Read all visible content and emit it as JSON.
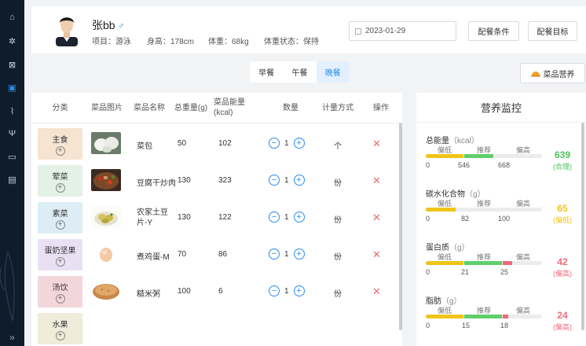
{
  "user": {
    "name": "张bb",
    "gender_symbol": "♂",
    "project": "项目：游泳",
    "height": "身高：178cm",
    "weight": "体重：68kg",
    "body_status": "体重状态：保持"
  },
  "header": {
    "date": "2023-01-29",
    "btn_conditions": "配餐条件",
    "btn_goals": "配餐目标"
  },
  "meals": [
    "早餐",
    "午餐",
    "晚餐"
  ],
  "active_meal": "晚餐",
  "nutrition_button": "菜品营养",
  "table": {
    "columns": [
      "分类",
      "菜品图片",
      "菜品名称",
      "总重量(g)",
      "菜品能量\n(kcal)",
      "数量",
      "计量方式",
      "操作"
    ],
    "categories": [
      {
        "label": "主食",
        "color": "#f6e3d0"
      },
      {
        "label": "荤菜",
        "color": "#e3f1e6"
      },
      {
        "label": "素菜",
        "color": "#dcedf5"
      },
      {
        "label": "蛋奶坚果",
        "color": "#e9e1f3"
      },
      {
        "label": "汤饮",
        "color": "#f3d6dc"
      },
      {
        "label": "水果",
        "color": "#efedd9"
      }
    ],
    "rows": [
      {
        "name": "菜包",
        "weight": "50",
        "energy": "102",
        "qty": "1",
        "unit": "个",
        "img": "bun"
      },
      {
        "name": "豆腐干炒肉",
        "weight": "130",
        "energy": "323",
        "qty": "1",
        "unit": "份",
        "img": "stirfry"
      },
      {
        "name": "农家土豆\n片-Y",
        "weight": "130",
        "energy": "122",
        "qty": "1",
        "unit": "份",
        "img": "potato"
      },
      {
        "name": "煮鸡蛋-M",
        "weight": "70",
        "energy": "86",
        "qty": "1",
        "unit": "份",
        "img": "egg"
      },
      {
        "name": "糙米粥",
        "weight": "100",
        "energy": "6",
        "qty": "1",
        "unit": "份",
        "img": "porridge"
      }
    ]
  },
  "monitor": {
    "title": "营养监控",
    "labels": {
      "low": "偏低",
      "rec": "推荐",
      "high": "偏高"
    },
    "items": [
      {
        "name": "总能量",
        "unit": "（kcal）",
        "ticks": [
          "0",
          "546",
          "668"
        ],
        "value": "639",
        "status": "(合理)",
        "color": "#4cc25a",
        "level": 0.59
      },
      {
        "name": "碳水化合物",
        "unit": "（g）",
        "ticks": [
          "0",
          "82",
          "100"
        ],
        "value": "65",
        "status": "(偏低)",
        "color": "#f0c419",
        "level": 0.2
      },
      {
        "name": "蛋白质",
        "unit": "（g）",
        "ticks": [
          "0",
          "21",
          "25"
        ],
        "value": "42",
        "status": "(偏高)",
        "color": "#f06a7a",
        "level": 0.68
      },
      {
        "name": "脂肪",
        "unit": "（g）",
        "ticks": [
          "0",
          "15",
          "18"
        ],
        "value": "24",
        "status": "(偏高)",
        "color": "#f06a7a",
        "level": 0.68
      }
    ]
  }
}
